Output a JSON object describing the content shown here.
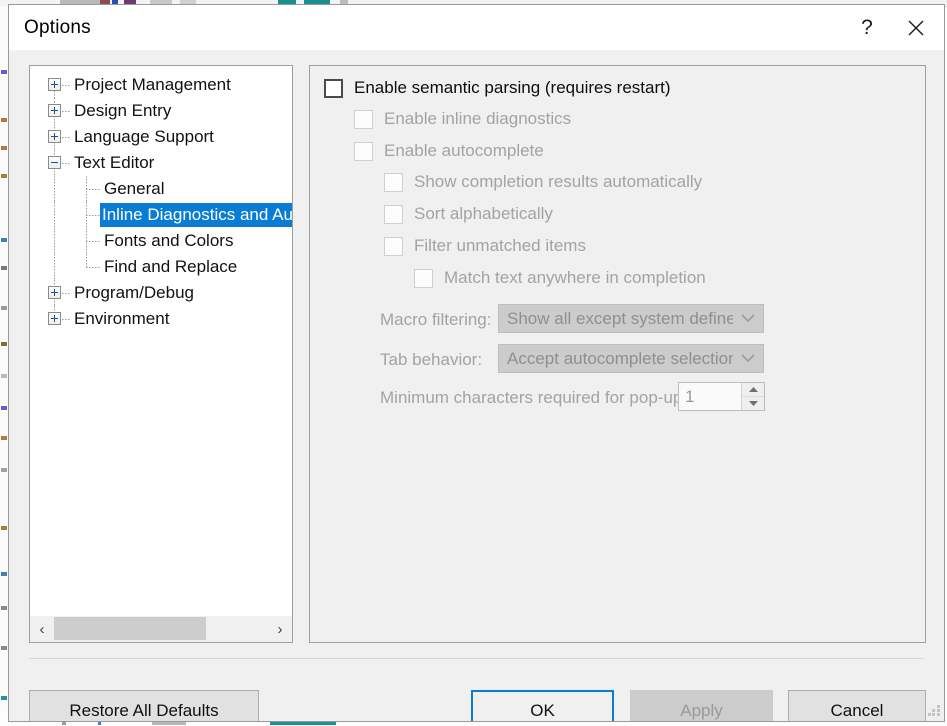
{
  "window": {
    "title": "Options",
    "help_icon": "question-mark-icon",
    "close_icon": "close-x-icon"
  },
  "tree": {
    "items": [
      {
        "label": "Project Management",
        "level": 0,
        "expander": "plus",
        "selected": false
      },
      {
        "label": "Design Entry",
        "level": 0,
        "expander": "plus",
        "selected": false
      },
      {
        "label": "Language Support",
        "level": 0,
        "expander": "plus",
        "selected": false
      },
      {
        "label": "Text Editor",
        "level": 0,
        "expander": "minus",
        "selected": false
      },
      {
        "label": "General",
        "level": 1,
        "expander": "none",
        "selected": false
      },
      {
        "label": "Inline Diagnostics and Autoc",
        "level": 1,
        "expander": "none",
        "selected": true
      },
      {
        "label": "Fonts and Colors",
        "level": 1,
        "expander": "none",
        "selected": false
      },
      {
        "label": "Find and Replace",
        "level": 1,
        "expander": "none",
        "selected": false
      },
      {
        "label": "Program/Debug",
        "level": 0,
        "expander": "plus",
        "selected": false
      },
      {
        "label": "Environment",
        "level": 0,
        "expander": "plus",
        "selected": false
      }
    ],
    "scrollbar": {
      "left_arrow": "‹",
      "right_arrow": "›"
    }
  },
  "options": {
    "checkboxes": [
      {
        "label": "Enable semantic parsing (requires restart)",
        "checked": false,
        "disabled": false,
        "indent": 0
      },
      {
        "label": "Enable inline diagnostics",
        "checked": false,
        "disabled": true,
        "indent": 1
      },
      {
        "label": "Enable autocomplete",
        "checked": false,
        "disabled": true,
        "indent": 1
      },
      {
        "label": "Show completion results automatically",
        "checked": false,
        "disabled": true,
        "indent": 2
      },
      {
        "label": "Sort alphabetically",
        "checked": false,
        "disabled": true,
        "indent": 2
      },
      {
        "label": "Filter unmatched items",
        "checked": false,
        "disabled": true,
        "indent": 2
      },
      {
        "label": "Match text anywhere in completion",
        "checked": false,
        "disabled": true,
        "indent": 3
      }
    ],
    "macro_filtering": {
      "label": "Macro filtering:",
      "value": "Show all except system defines",
      "disabled": true
    },
    "tab_behavior": {
      "label": "Tab behavior:",
      "value": "Accept autocomplete selection",
      "disabled": true
    },
    "min_chars": {
      "label": "Minimum characters required for pop-up:",
      "value": "1",
      "disabled": true
    }
  },
  "footer": {
    "restore_label": "Restore All Defaults",
    "ok_label": "OK",
    "apply_label": "Apply",
    "cancel_label": "Cancel"
  },
  "colors": {
    "selection_blue": "#0a7cd4",
    "dialog_bg": "#f0f0f0",
    "panel_white": "#ffffff",
    "disabled_text": "#a3a3a3"
  }
}
